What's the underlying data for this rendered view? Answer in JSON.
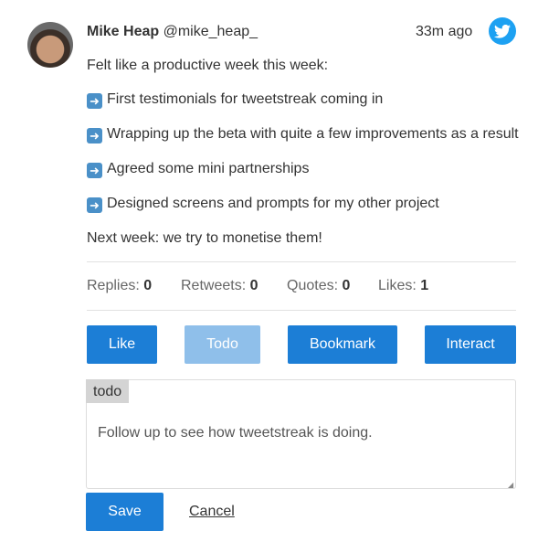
{
  "tweet": {
    "author": "Mike Heap",
    "handle": "@mike_heap_",
    "time": "33m ago",
    "lines": [
      "Felt like a productive week this week:",
      "First testimonials for tweetstreak coming in",
      "Wrapping up the beta with quite a few improvements as a result",
      "Agreed some mini partnerships",
      "Designed screens and prompts for my other project",
      "Next week: we try to monetise them!"
    ]
  },
  "stats": {
    "replies_label": "Replies:",
    "replies": "0",
    "retweets_label": "Retweets:",
    "retweets": "0",
    "quotes_label": "Quotes:",
    "quotes": "0",
    "likes_label": "Likes:",
    "likes": "1"
  },
  "actions": {
    "like": "Like",
    "todo": "Todo",
    "bookmark": "Bookmark",
    "interact": "Interact"
  },
  "note": {
    "tag": "todo",
    "text": "Follow up to see how tweetstreak is doing.",
    "save": "Save",
    "cancel": "Cancel"
  },
  "colors": {
    "primary": "#1c7ed6",
    "disabled": "#8fbfea",
    "twitter": "#1da1f2"
  }
}
